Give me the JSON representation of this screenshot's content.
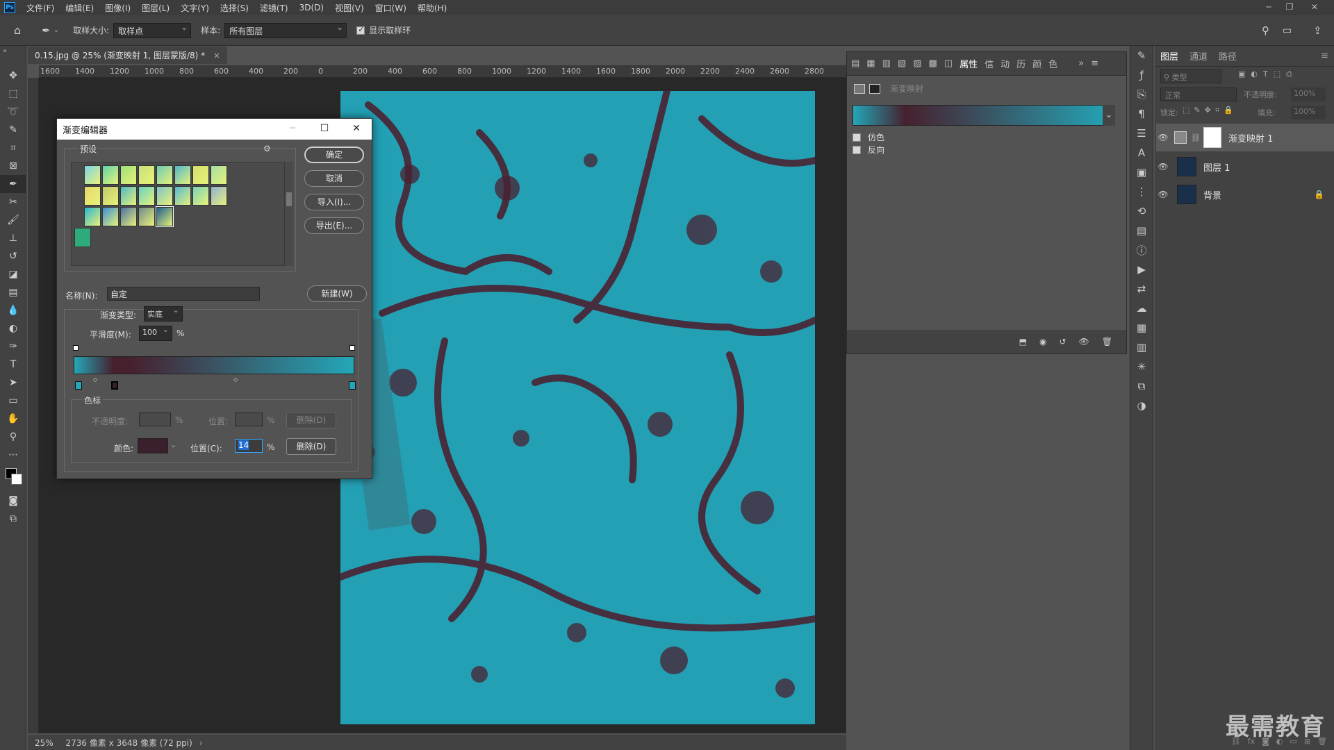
{
  "menu": [
    "文件(F)",
    "编辑(E)",
    "图像(I)",
    "图层(L)",
    "文字(Y)",
    "选择(S)",
    "滤镜(T)",
    "3D(D)",
    "视图(V)",
    "窗口(W)",
    "帮助(H)"
  ],
  "app_logo": "Ps",
  "options": {
    "sample_size_label": "取样大小:",
    "sample_size_value": "取样点",
    "sample_label": "样本:",
    "sample_value": "所有图层",
    "show_ring_label": "显示取样环"
  },
  "document_tab": "0.15.jpg @ 25% (渐变映射 1, 图层蒙版/8) *",
  "ruler_ticks": [
    "1600",
    "1400",
    "1200",
    "1000",
    "800",
    "600",
    "400",
    "200",
    "0",
    "200",
    "400",
    "600",
    "800",
    "1000",
    "1200",
    "1400",
    "1600",
    "1800",
    "2000",
    "2200",
    "2400",
    "2600",
    "2800"
  ],
  "status": {
    "zoom": "25%",
    "doc_size": "2736 像素 x 3648 像素 (72 ppi)"
  },
  "properties": {
    "tab_active": "属性",
    "other_tabs": [
      "信",
      "动",
      "历",
      "颜",
      "色"
    ],
    "title": "渐变映射",
    "dither_label": "仿色",
    "reverse_label": "反向",
    "colors": {
      "start": "#23a7b8",
      "end": "#47202e"
    }
  },
  "layers_panel": {
    "tabs": [
      "图层",
      "通道",
      "路径"
    ],
    "filter_placeholder": "类型",
    "blend_mode": "正常",
    "opacity_label": "不透明度:",
    "opacity_value": "100%",
    "lock_label": "锁定:",
    "fill_label": "填充:",
    "fill_value": "100%",
    "layers": [
      {
        "name": "渐变映射 1",
        "type": "adjustment"
      },
      {
        "name": "图层 1",
        "type": "image"
      },
      {
        "name": "背景",
        "type": "image",
        "locked": true
      }
    ]
  },
  "dialog": {
    "title": "渐变编辑器",
    "presets_label": "预设",
    "ok": "确定",
    "cancel": "取消",
    "import": "导入(I)...",
    "export": "导出(E)...",
    "name_label": "名称(N):",
    "name_value": "自定",
    "new_button": "新建(W)",
    "gradient_type_label": "渐变类型:",
    "gradient_type_value": "实底",
    "smoothness_label": "平滑度(M):",
    "smoothness_value": "100",
    "percent": "%",
    "stops_label": "色标",
    "opacity_label": "不透明度:",
    "position_label": "位置:",
    "delete_label": "删除(D)",
    "color_label": "颜色:",
    "position_c_label": "位置(C):",
    "position_c_value": "14",
    "stop_color": "#3a1f2c",
    "preset_colors": [
      "#7ed3e5",
      "#5fd3a8",
      "#9be07a",
      "#c9e07a",
      "#6dcbb3",
      "#4fb8c9",
      "#d4e06b",
      "#a4dfa4",
      "#e6d76b",
      "#c1c86a",
      "#4dbbc6",
      "#66d3c2",
      "#7ec3c7",
      "#55b8d3",
      "#7ad1b6",
      "#8fb0d4",
      "#2bb7cf",
      "#3a8fd6",
      "#4b6fa4",
      "#6e8a8a",
      "#1b5f8e",
      "#2faa7a"
    ]
  },
  "watermark": "最需教育"
}
